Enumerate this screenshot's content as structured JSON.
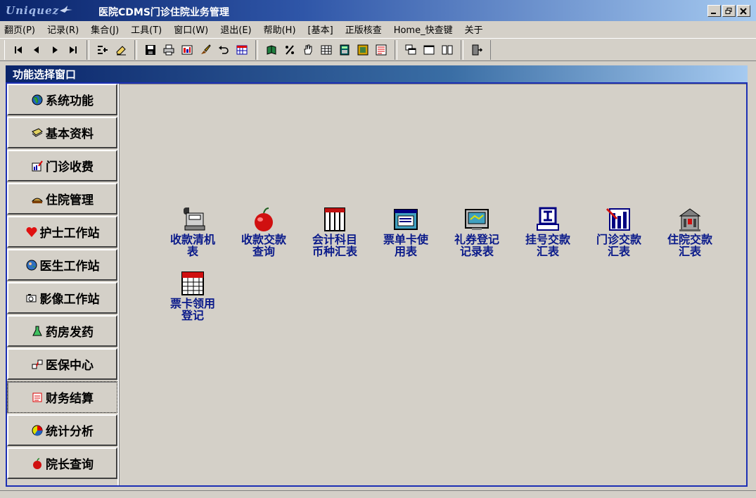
{
  "window": {
    "logo_text": "Uniquez",
    "title": "医院CDMS门诊住院业务管理"
  },
  "menu": [
    "翻页(P)",
    "记录(R)",
    "集合(J)",
    "工具(T)",
    "窗口(W)",
    "退出(E)",
    "帮助(H)",
    "[基本]",
    "正版核查",
    "Home_快查键",
    "关于"
  ],
  "toolbar": {
    "nav": [
      "first-record-icon",
      "prev-record-icon",
      "next-record-icon",
      "last-record-icon"
    ],
    "edit": [
      "outline-icon",
      "eraser-icon"
    ],
    "file": [
      "save-icon",
      "print-icon",
      "report-icon",
      "brush-icon",
      "undo-icon",
      "grid-report-icon"
    ],
    "tools": [
      "book-icon",
      "percent-icon",
      "hand-icon",
      "table-icon",
      "calculator-icon",
      "tile-icon",
      "form-icon"
    ],
    "window": [
      "cascade-icon",
      "maximize-window-icon",
      "tile-vertical-icon"
    ],
    "exit": [
      "exit-door-icon"
    ]
  },
  "panel": {
    "title": "功能选择窗口"
  },
  "nav": [
    {
      "label": "系统功能",
      "icon": "globe-icon"
    },
    {
      "label": "基本资料",
      "icon": "documents-icon"
    },
    {
      "label": "门诊收费",
      "icon": "chart-pen-icon"
    },
    {
      "label": "住院管理",
      "icon": "bed-icon"
    },
    {
      "label": "护士工作站",
      "icon": "heart-icon"
    },
    {
      "label": "医生工作站",
      "icon": "globe-person-icon"
    },
    {
      "label": "影像工作站",
      "icon": "camera-icon"
    },
    {
      "label": "药房发药",
      "icon": "flask-icon"
    },
    {
      "label": "医保中心",
      "icon": "network-icon"
    },
    {
      "label": "财务结算",
      "icon": "ledger-icon",
      "active": true
    },
    {
      "label": "统计分析",
      "icon": "pie-icon"
    },
    {
      "label": "院长查询",
      "icon": "apple-icon"
    }
  ],
  "tiles": [
    {
      "line1": "收款清机",
      "line2": "表",
      "icon": "cash-register-icon"
    },
    {
      "line1": "收款交款",
      "line2": "查询",
      "icon": "apple-query-icon"
    },
    {
      "line1": "会计科目",
      "line2": "币种汇表",
      "icon": "ledger-grid-icon"
    },
    {
      "line1": "票单卡使",
      "line2": "用表",
      "icon": "card-window-icon"
    },
    {
      "line1": "礼券登记",
      "line2": "记录表",
      "icon": "voucher-monitor-icon"
    },
    {
      "line1": "挂号交款",
      "line2": "汇表",
      "icon": "registration-icon"
    },
    {
      "line1": "门诊交款",
      "line2": "汇表",
      "icon": "outpatient-report-icon"
    },
    {
      "line1": "住院交款",
      "line2": "汇表",
      "icon": "hospital-building-icon"
    },
    {
      "line1": "票卡领用",
      "line2": "登记",
      "icon": "ticket-grid-icon"
    }
  ]
}
